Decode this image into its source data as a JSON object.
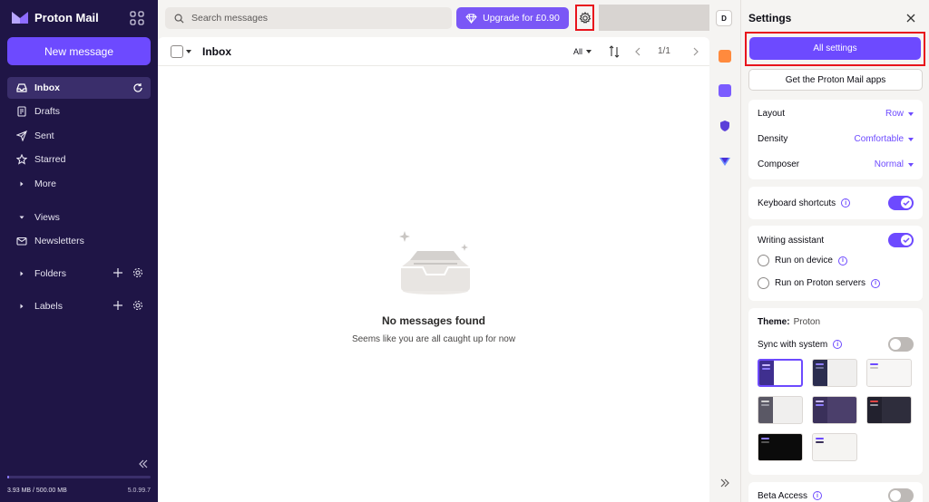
{
  "sidebar": {
    "brand": "Proton Mail",
    "new_message": "New message",
    "items": [
      {
        "label": "Inbox"
      },
      {
        "label": "Drafts"
      },
      {
        "label": "Sent"
      },
      {
        "label": "Starred"
      },
      {
        "label": "More"
      },
      {
        "label": "Views"
      },
      {
        "label": "Newsletters"
      },
      {
        "label": "Folders"
      },
      {
        "label": "Labels"
      }
    ],
    "storage": "3.93 MB / 500.00 MB",
    "storage_fraction": 0.008,
    "version": "5.0.99.7"
  },
  "topbar": {
    "search_placeholder": "Search messages",
    "upgrade": "Upgrade for £0.90",
    "avatar": "D"
  },
  "list": {
    "title": "Inbox",
    "filter": "All",
    "pager": "1/1",
    "empty_title": "No messages found",
    "empty_sub": "Seems like you are all caught up for now"
  },
  "settings": {
    "title": "Settings",
    "all_settings": "All settings",
    "get_apps": "Get the Proton Mail apps",
    "layout_label": "Layout",
    "layout_value": "Row",
    "density_label": "Density",
    "density_value": "Comfortable",
    "composer_label": "Composer",
    "composer_value": "Normal",
    "shortcuts_label": "Keyboard shortcuts",
    "shortcuts_on": true,
    "assistant_label": "Writing assistant",
    "assistant_on": true,
    "run_device": "Run on device",
    "run_servers": "Run on Proton servers",
    "theme_label": "Theme:",
    "theme_value": "Proton",
    "sync_label": "Sync with system",
    "sync_on": false,
    "beta_label": "Beta Access",
    "beta_on": false
  },
  "colors": {
    "accent": "#6d4aff",
    "sidebar_bg": "#1f1546",
    "highlight": "#e8141c"
  }
}
